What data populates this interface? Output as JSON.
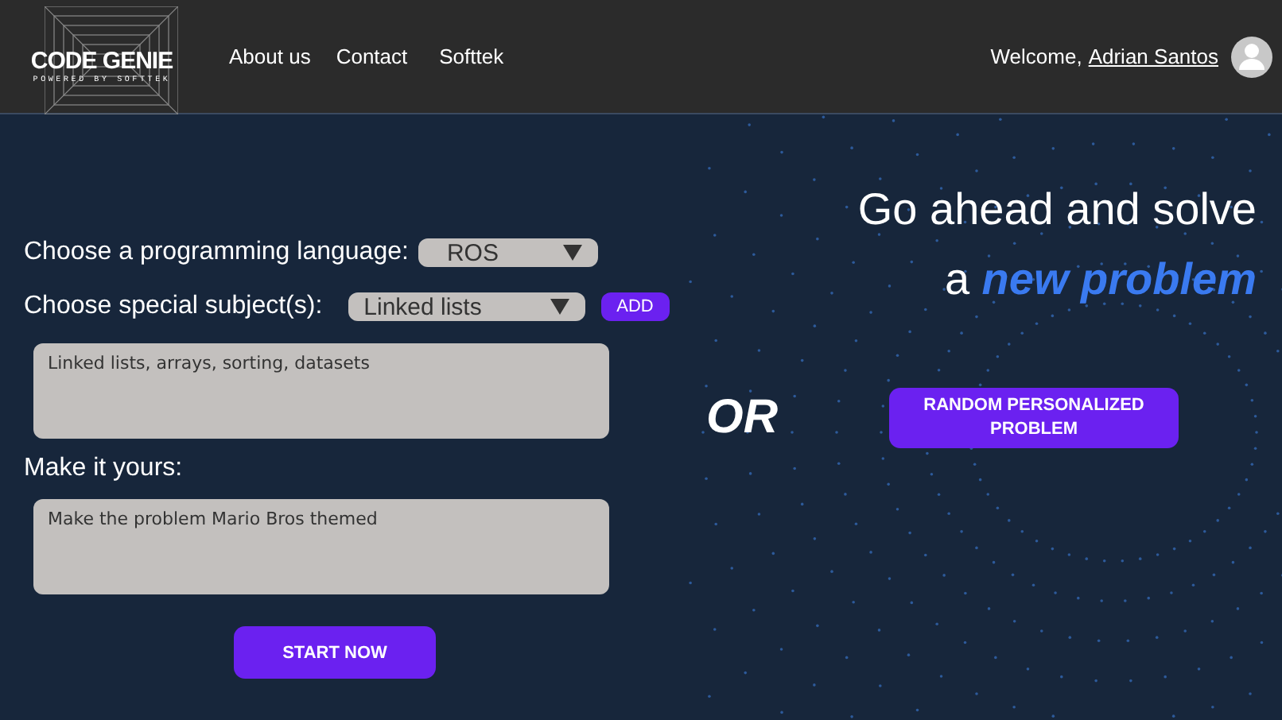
{
  "header": {
    "logo": {
      "title": "CODE GENIE",
      "subtitle": "POWERED BY SOFTTEK"
    },
    "nav": [
      "About us",
      "Contact",
      "Softtek"
    ],
    "welcome": "Welcome,",
    "user": "Adrian Santos"
  },
  "form": {
    "language_label": "Choose a programming language:",
    "language": "ROS",
    "subject_label": "Choose special subject(s):",
    "subject": "Linked lists",
    "add_button": "ADD",
    "subjects_text": "Linked lists, arrays, sorting, datasets",
    "custom_label": "Make it yours:",
    "custom_text": "Make the problem Mario Bros themed",
    "start_button": "START NOW"
  },
  "or_label": "OR",
  "headline": [
    "Go ahead and solve",
    "a **new problem**"
  ],
  "random_button": "RANDOM PERSONALIZED PROBLEM"
}
